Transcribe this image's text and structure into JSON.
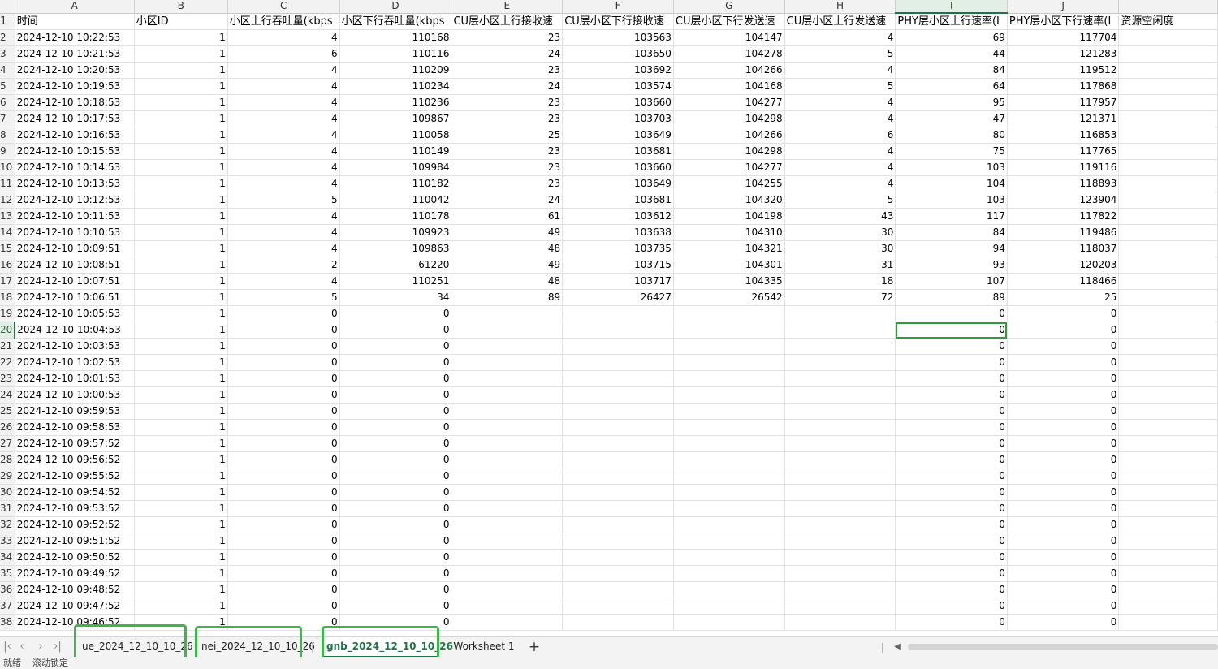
{
  "columns": [
    "A",
    "B",
    "C",
    "D",
    "E",
    "F",
    "G",
    "H",
    "I",
    "J",
    ""
  ],
  "header_row": {
    "row_num": "1",
    "cells": [
      "时间",
      "小区ID",
      "小区上行吞吐量(kbps",
      "小区下行吞吐量(kbps",
      "CU层小区上行接收速",
      "CU层小区下行接收速",
      "CU层小区下行发送速",
      "CU层小区上行发送速",
      "PHY层小区上行速率(I",
      "PHY层小区下行速率(I",
      "资源空闲度"
    ]
  },
  "rows": [
    {
      "n": "2",
      "cells": [
        "2024-12-10 10:22:53",
        "1",
        "4",
        "110168",
        "23",
        "103563",
        "104147",
        "4",
        "69",
        "117704",
        ""
      ]
    },
    {
      "n": "3",
      "cells": [
        "2024-12-10 10:21:53",
        "1",
        "6",
        "110116",
        "24",
        "103650",
        "104278",
        "5",
        "44",
        "121283",
        ""
      ]
    },
    {
      "n": "4",
      "cells": [
        "2024-12-10 10:20:53",
        "1",
        "4",
        "110209",
        "23",
        "103692",
        "104266",
        "4",
        "84",
        "119512",
        ""
      ]
    },
    {
      "n": "5",
      "cells": [
        "2024-12-10 10:19:53",
        "1",
        "4",
        "110234",
        "24",
        "103574",
        "104168",
        "5",
        "64",
        "117868",
        ""
      ]
    },
    {
      "n": "6",
      "cells": [
        "2024-12-10 10:18:53",
        "1",
        "4",
        "110236",
        "23",
        "103660",
        "104277",
        "4",
        "95",
        "117957",
        ""
      ]
    },
    {
      "n": "7",
      "cells": [
        "2024-12-10 10:17:53",
        "1",
        "4",
        "109867",
        "23",
        "103703",
        "104298",
        "4",
        "47",
        "121371",
        ""
      ]
    },
    {
      "n": "8",
      "cells": [
        "2024-12-10 10:16:53",
        "1",
        "4",
        "110058",
        "25",
        "103649",
        "104266",
        "6",
        "80",
        "116853",
        ""
      ]
    },
    {
      "n": "9",
      "cells": [
        "2024-12-10 10:15:53",
        "1",
        "4",
        "110149",
        "23",
        "103681",
        "104298",
        "4",
        "75",
        "117765",
        ""
      ]
    },
    {
      "n": "10",
      "cells": [
        "2024-12-10 10:14:53",
        "1",
        "4",
        "109984",
        "23",
        "103660",
        "104277",
        "4",
        "103",
        "119116",
        ""
      ]
    },
    {
      "n": "11",
      "cells": [
        "2024-12-10 10:13:53",
        "1",
        "4",
        "110182",
        "23",
        "103649",
        "104255",
        "4",
        "104",
        "118893",
        ""
      ]
    },
    {
      "n": "12",
      "cells": [
        "2024-12-10 10:12:53",
        "1",
        "5",
        "110042",
        "24",
        "103681",
        "104320",
        "5",
        "103",
        "123904",
        ""
      ]
    },
    {
      "n": "13",
      "cells": [
        "2024-12-10 10:11:53",
        "1",
        "4",
        "110178",
        "61",
        "103612",
        "104198",
        "43",
        "117",
        "117822",
        ""
      ]
    },
    {
      "n": "14",
      "cells": [
        "2024-12-10 10:10:53",
        "1",
        "4",
        "109923",
        "49",
        "103638",
        "104310",
        "30",
        "84",
        "119486",
        ""
      ]
    },
    {
      "n": "15",
      "cells": [
        "2024-12-10 10:09:51",
        "1",
        "4",
        "109863",
        "48",
        "103735",
        "104321",
        "30",
        "94",
        "118037",
        ""
      ]
    },
    {
      "n": "16",
      "cells": [
        "2024-12-10 10:08:51",
        "1",
        "2",
        "61220",
        "49",
        "103715",
        "104301",
        "31",
        "93",
        "120203",
        ""
      ]
    },
    {
      "n": "17",
      "cells": [
        "2024-12-10 10:07:51",
        "1",
        "4",
        "110251",
        "48",
        "103717",
        "104335",
        "18",
        "107",
        "118466",
        ""
      ]
    },
    {
      "n": "18",
      "cells": [
        "2024-12-10 10:06:51",
        "1",
        "5",
        "34",
        "89",
        "26427",
        "26542",
        "72",
        "89",
        "25",
        ""
      ]
    },
    {
      "n": "19",
      "cells": [
        "2024-12-10 10:05:53",
        "1",
        "0",
        "0",
        "",
        "",
        "",
        "",
        "0",
        "0",
        ""
      ]
    },
    {
      "n": "20",
      "cells": [
        "2024-12-10 10:04:53",
        "1",
        "0",
        "0",
        "",
        "",
        "",
        "",
        "0",
        "0",
        ""
      ]
    },
    {
      "n": "21",
      "cells": [
        "2024-12-10 10:03:53",
        "1",
        "0",
        "0",
        "",
        "",
        "",
        "",
        "0",
        "0",
        ""
      ]
    },
    {
      "n": "22",
      "cells": [
        "2024-12-10 10:02:53",
        "1",
        "0",
        "0",
        "",
        "",
        "",
        "",
        "0",
        "0",
        ""
      ]
    },
    {
      "n": "23",
      "cells": [
        "2024-12-10 10:01:53",
        "1",
        "0",
        "0",
        "",
        "",
        "",
        "",
        "0",
        "0",
        ""
      ]
    },
    {
      "n": "24",
      "cells": [
        "2024-12-10 10:00:53",
        "1",
        "0",
        "0",
        "",
        "",
        "",
        "",
        "0",
        "0",
        ""
      ]
    },
    {
      "n": "25",
      "cells": [
        "2024-12-10 09:59:53",
        "1",
        "0",
        "0",
        "",
        "",
        "",
        "",
        "0",
        "0",
        ""
      ]
    },
    {
      "n": "26",
      "cells": [
        "2024-12-10 09:58:53",
        "1",
        "0",
        "0",
        "",
        "",
        "",
        "",
        "0",
        "0",
        ""
      ]
    },
    {
      "n": "27",
      "cells": [
        "2024-12-10 09:57:52",
        "1",
        "0",
        "0",
        "",
        "",
        "",
        "",
        "0",
        "0",
        ""
      ]
    },
    {
      "n": "28",
      "cells": [
        "2024-12-10 09:56:52",
        "1",
        "0",
        "0",
        "",
        "",
        "",
        "",
        "0",
        "0",
        ""
      ]
    },
    {
      "n": "29",
      "cells": [
        "2024-12-10 09:55:52",
        "1",
        "0",
        "0",
        "",
        "",
        "",
        "",
        "0",
        "0",
        ""
      ]
    },
    {
      "n": "30",
      "cells": [
        "2024-12-10 09:54:52",
        "1",
        "0",
        "0",
        "",
        "",
        "",
        "",
        "0",
        "0",
        ""
      ]
    },
    {
      "n": "31",
      "cells": [
        "2024-12-10 09:53:52",
        "1",
        "0",
        "0",
        "",
        "",
        "",
        "",
        "0",
        "0",
        ""
      ]
    },
    {
      "n": "32",
      "cells": [
        "2024-12-10 09:52:52",
        "1",
        "0",
        "0",
        "",
        "",
        "",
        "",
        "0",
        "0",
        ""
      ]
    },
    {
      "n": "33",
      "cells": [
        "2024-12-10 09:51:52",
        "1",
        "0",
        "0",
        "",
        "",
        "",
        "",
        "0",
        "0",
        ""
      ]
    },
    {
      "n": "34",
      "cells": [
        "2024-12-10 09:50:52",
        "1",
        "0",
        "0",
        "",
        "",
        "",
        "",
        "0",
        "0",
        ""
      ]
    },
    {
      "n": "35",
      "cells": [
        "2024-12-10 09:49:52",
        "1",
        "0",
        "0",
        "",
        "",
        "",
        "",
        "0",
        "0",
        ""
      ]
    },
    {
      "n": "36",
      "cells": [
        "2024-12-10 09:48:52",
        "1",
        "0",
        "0",
        "",
        "",
        "",
        "",
        "0",
        "0",
        ""
      ]
    },
    {
      "n": "37",
      "cells": [
        "2024-12-10 09:47:52",
        "1",
        "0",
        "0",
        "",
        "",
        "",
        "",
        "0",
        "0",
        ""
      ]
    },
    {
      "n": "38",
      "cells": [
        "2024-12-10 09:46:52",
        "1",
        "0",
        "0",
        "",
        "",
        "",
        "",
        "0",
        "0",
        ""
      ]
    }
  ],
  "active_cell": {
    "row": "20",
    "col": "I"
  },
  "tabs": [
    {
      "label": "ue_2024_12_10_10_26",
      "active": false,
      "highlighted": true
    },
    {
      "label": "nei_2024_12_10_10_26",
      "active": false,
      "highlighted": true
    },
    {
      "label": "gnb_2024_12_10_10_26",
      "active": true,
      "highlighted": true
    },
    {
      "label": "Worksheet 1",
      "active": false,
      "highlighted": false
    }
  ],
  "tab_nav_icons": [
    "first-sheet-icon",
    "prev-sheet-icon",
    "next-sheet-icon",
    "last-sheet-icon"
  ],
  "add_sheet_label": "+",
  "statusbar": {
    "left": "就绪",
    "scroll_lock": "滚动锁定"
  },
  "colors": {
    "accent": "#217346",
    "highlight_box": "#3cb74a",
    "active_cell_border": "#2e9b3c"
  }
}
